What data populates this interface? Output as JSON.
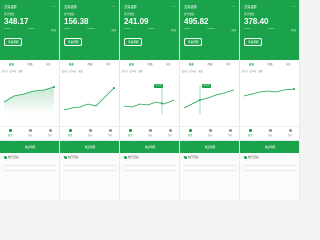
{
  "colors": {
    "brand": "#1aa34a",
    "background": "#f2f4f3",
    "panel": "#ffffff"
  },
  "panels": [
    {
      "title": "交易金额",
      "subtitle": "累计收益",
      "amount": "348.17",
      "stats": [
        "+0.00",
        "+0.00%",
        "昨日"
      ],
      "pill": "查看明细",
      "tabs": [
        "收益",
        "明细",
        "排行"
      ],
      "filters": [
        "近7日",
        "近30日",
        "全部"
      ],
      "section": "热门活动",
      "nav": [
        "首页",
        "收益",
        "我的"
      ],
      "lower": "收益明细"
    },
    {
      "title": "交易金额",
      "subtitle": "累计收益",
      "amount": "156.38",
      "stats": [
        "+0.00",
        "+0.00%",
        "昨日"
      ],
      "pill": "查看明细",
      "tabs": [
        "收益",
        "明细",
        "排行"
      ],
      "filters": [
        "近7日",
        "近30日",
        "全部"
      ],
      "section": "热门活动",
      "nav": [
        "首页",
        "收益",
        "我的"
      ],
      "lower": "收益明细"
    },
    {
      "title": "交易金额",
      "subtitle": "累计收益",
      "amount": "241.09",
      "stats": [
        "+0.00",
        "+0.00%",
        "昨日"
      ],
      "pill": "查看明细",
      "tabs": [
        "收益",
        "明细",
        "排行"
      ],
      "filters": [
        "近7日",
        "近30日",
        "全部"
      ],
      "section": "热门活动",
      "nav": [
        "首页",
        "收益",
        "我的"
      ],
      "lower": "收益明细"
    },
    {
      "title": "交易金额",
      "subtitle": "累计收益",
      "amount": "495.82",
      "stats": [
        "+0.00",
        "+0.00%",
        "昨日"
      ],
      "pill": "查看明细",
      "tabs": [
        "收益",
        "明细",
        "排行"
      ],
      "filters": [
        "近7日",
        "近30日",
        "全部"
      ],
      "section": "热门活动",
      "nav": [
        "首页",
        "收益",
        "我的"
      ],
      "lower": "收益明细"
    },
    {
      "title": "交易金额",
      "subtitle": "累计收益",
      "amount": "378.40",
      "stats": [
        "+0.00",
        "+0.00%",
        "昨日"
      ],
      "pill": "查看明细",
      "tabs": [
        "收益",
        "明细",
        "排行"
      ],
      "filters": [
        "近7日",
        "近30日",
        "全部"
      ],
      "section": "热门活动",
      "nav": [
        "首页",
        "收益",
        "我的"
      ],
      "lower": "收益明细"
    }
  ]
}
